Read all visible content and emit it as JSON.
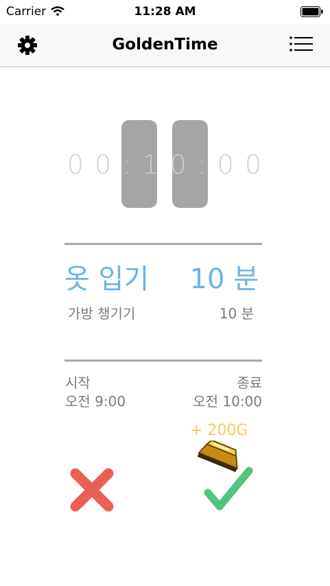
{
  "status_bar": {
    "carrier": "Carrier",
    "time": "11:28 AM"
  },
  "nav": {
    "title": "GoldenTime",
    "left_icon": "gear-icon",
    "right_icon": "list-icon"
  },
  "timer": {
    "display": "0 0 : 1 0 : 0 0"
  },
  "task": {
    "current_name": "옷 입기",
    "current_duration": "10 분",
    "next_name": "가방 챙기기",
    "next_duration": "10 분"
  },
  "schedule": {
    "start_label": "시작",
    "start_time": "오전 9:00",
    "end_label": "종료",
    "end_time": "오전 10:00"
  },
  "reward": {
    "text": "+ 200G",
    "icon": "gold-bar-icon"
  },
  "actions": {
    "cancel_icon": "cancel-x-icon",
    "confirm_icon": "checkmark-icon"
  },
  "colors": {
    "accent_blue": "#6bb3e3",
    "reward_gold": "#f6c85e",
    "cancel_red": "#ea5f54",
    "confirm_green": "#52c47f",
    "timer_block": "#a5a5a5"
  }
}
